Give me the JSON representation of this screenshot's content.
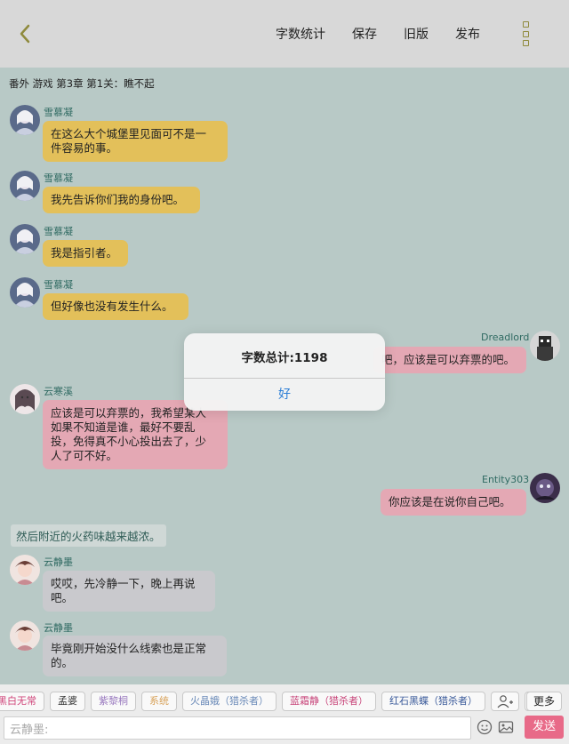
{
  "header": {
    "actions": [
      "字数统计",
      "保存",
      "旧版",
      "发布"
    ]
  },
  "chapter_title": "番外 游戏 第3章 第1关：瞧不起",
  "messages": [
    {
      "name": "雪慕凝",
      "text_lines": [
        "在这么大个城堡里见面可不是一",
        "件容易的事。"
      ],
      "color": "yellow"
    },
    {
      "name": "雪慕凝",
      "text_lines": [
        "我先告诉你们我的身份吧。"
      ],
      "color": "yellow"
    },
    {
      "name": "雪慕凝",
      "text_lines": [
        "我是指引者。"
      ],
      "color": "yellow"
    },
    {
      "name": "雪慕凝",
      "text_lines": [
        "但好像也没有发生什么。"
      ],
      "color": "yellow"
    },
    {
      "name": "Dreadlord",
      "text_lines": [
        "吧，应该是可以弃票的吧。"
      ],
      "color": "pink"
    },
    {
      "name": "云寒溪",
      "text_lines": [
        "应该是可以弃票的，我希望某人",
        "如果不知道是谁，最好不要乱",
        "投，免得真不小心投出去了，少",
        "人了可不好。"
      ],
      "color": "pink"
    },
    {
      "name": "Entity303",
      "text_lines": [
        "你应该是在说你自己吧。"
      ],
      "color": "pink"
    },
    {
      "name": "云静墨",
      "text_lines": [
        "哎哎，先冷静一下，晚上再说",
        "吧。"
      ],
      "color": "grey"
    },
    {
      "name": "云静墨",
      "text_lines": [
        "毕竟刚开始没什么线索也是正常",
        "的。"
      ],
      "color": "grey"
    }
  ],
  "narration": "然后附近的火药味越来越浓。",
  "dialog": {
    "message": "字数总计:1198",
    "ok_label": "好"
  },
  "bottom": {
    "chips": [
      {
        "label": "黑白无常",
        "color": "#d0457a"
      },
      {
        "label": "孟婆",
        "color": "#333333"
      },
      {
        "label": "紫黎桐",
        "color": "#9a7abf"
      },
      {
        "label": "系统",
        "color": "#d8a25a"
      },
      {
        "label": "火晶娥（猎杀者）",
        "color": "#6a8ab8"
      },
      {
        "label": "蓝霜静（猎杀者）",
        "color": "#c8457a"
      },
      {
        "label": "红石黑蝶（猎杀者）",
        "color": "#3a5a9a"
      }
    ],
    "more_label": "更多",
    "input_placeholder": "云静墨:",
    "send_label": "发送"
  }
}
